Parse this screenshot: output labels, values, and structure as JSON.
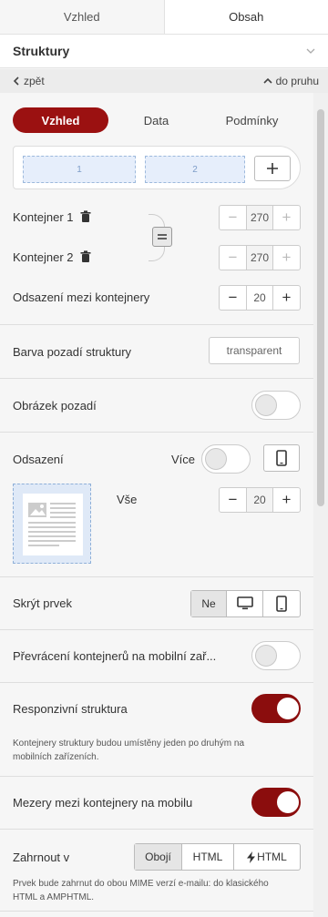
{
  "tabs": [
    {
      "label": "Vzhled"
    },
    {
      "label": "Obsah"
    }
  ],
  "section": {
    "title": "Struktury"
  },
  "nav": {
    "back_label": "zpět",
    "forward_label": "do pruhu"
  },
  "view_tabs": [
    {
      "label": "Vzhled"
    },
    {
      "label": "Data"
    },
    {
      "label": "Podmínky"
    }
  ],
  "columns": [
    {
      "label": "1"
    },
    {
      "label": "2"
    }
  ],
  "container1": {
    "label": "Kontejner 1",
    "value": "270"
  },
  "container2": {
    "label": "Kontejner 2",
    "value": "270"
  },
  "gap": {
    "label": "Odsazení mezi kontejnery",
    "value": "20"
  },
  "bgcolor": {
    "label": "Barva pozadí struktury",
    "value": "transparent"
  },
  "bgimage": {
    "label": "Obrázek pozadí"
  },
  "padding": {
    "label": "Odsazení",
    "more_label": "Více",
    "all_label": "Vše",
    "value": "20"
  },
  "hide": {
    "label": "Skrýt prvek",
    "no_label": "Ne"
  },
  "reverse": {
    "label": "Převrácení kontejnerů na mobilní zař..."
  },
  "responsive": {
    "label": "Responzivní struktura",
    "note": "Kontejnery struktury budou umístěny jeden po druhým na mobilních zařízeních."
  },
  "mobile_gap": {
    "label": "Mezery mezi kontejnery na mobilu"
  },
  "include": {
    "label": "Zahrnout v",
    "options": [
      "Obojí",
      "HTML",
      "HTML"
    ],
    "note": "Prvek bude zahrnut do obou MIME verzí e-mailu: do klasického HTML a AMPHTML."
  },
  "colors": {
    "accent": "#9b1111",
    "column_fill": "#e6eefb"
  }
}
